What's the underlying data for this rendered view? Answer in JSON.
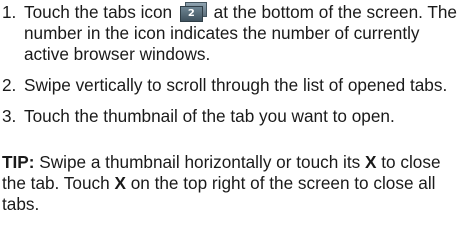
{
  "steps": [
    {
      "number": "1.",
      "text_before_icon": "Touch the tabs icon",
      "icon_count": "2",
      "text_after_icon": "at the bottom of the screen. The number in the icon indicates the number of currently active browser windows."
    },
    {
      "number": "2.",
      "text": "Swipe vertically to scroll through the list of opened tabs."
    },
    {
      "number": "3.",
      "text": "Touch the thumbnail of the tab you want to open."
    }
  ],
  "tip": {
    "label": "TIP:",
    "part1": "Swipe a thumbnail horizontally or touch its",
    "x1": "X",
    "part2": "to close the tab. Touch",
    "x2": "X",
    "part3": "on the top right of the screen to close all tabs."
  }
}
